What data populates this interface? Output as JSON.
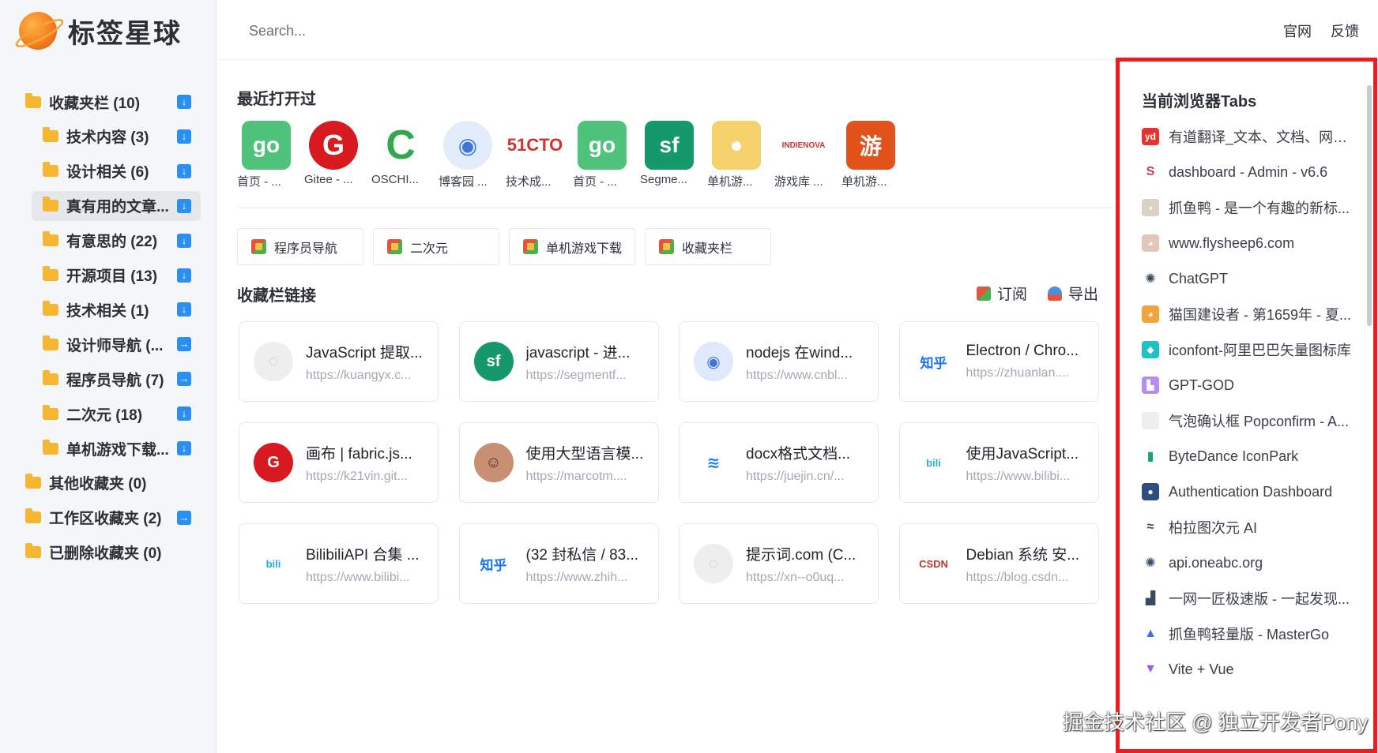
{
  "app": {
    "logo_text": "标签星球",
    "search_placeholder": "Search...",
    "links": [
      "官网",
      "反馈"
    ]
  },
  "sidebar": {
    "folders": [
      {
        "label": "收藏夹栏 (10)",
        "level": 0,
        "action": "download-icon"
      },
      {
        "label": "技术内容 (3)",
        "level": 1,
        "action": "download-icon"
      },
      {
        "label": "设计相关 (6)",
        "level": 1,
        "action": "download-icon"
      },
      {
        "label": "真有用的文章...",
        "level": 1,
        "action": "download-icon",
        "active": true
      },
      {
        "label": "有意思的 (22)",
        "level": 1,
        "action": "download-icon"
      },
      {
        "label": "开源项目 (13)",
        "level": 1,
        "action": "download-icon"
      },
      {
        "label": "技术相关 (1)",
        "level": 1,
        "action": "download-icon"
      },
      {
        "label": "设计师导航 (...",
        "level": 1,
        "action": "arrow-right-icon"
      },
      {
        "label": "程序员导航 (7)",
        "level": 1,
        "action": "arrow-right-icon"
      },
      {
        "label": "二次元 (18)",
        "level": 1,
        "action": "download-icon"
      },
      {
        "label": "单机游戏下载...",
        "level": 1,
        "action": "download-icon"
      },
      {
        "label": "其他收藏夹 (0)",
        "level": 0,
        "action": null
      },
      {
        "label": "工作区收藏夹 (2)",
        "level": 0,
        "action": "arrow-right-icon"
      },
      {
        "label": "已删除收藏夹 (0)",
        "level": 0,
        "action": null
      }
    ]
  },
  "recent": {
    "title": "最近打开过",
    "items": [
      {
        "label": "首页 - ...",
        "icon": "90-icon",
        "color": "#4fc37b",
        "glyph": "ɡo"
      },
      {
        "label": "Gitee - ...",
        "icon": "gitee-icon",
        "color": "#d71920",
        "glyph": "G"
      },
      {
        "label": "OSCHI...",
        "icon": "oschina-icon",
        "color": "#2fa84f",
        "glyph": "C"
      },
      {
        "label": "博客园 ...",
        "icon": "cnblogs-icon",
        "color": "#3d76d6",
        "glyph": "◉"
      },
      {
        "label": "技术成...",
        "icon": "51cto-icon",
        "color": "#ffffff",
        "glyph": "51CTO"
      },
      {
        "label": "首页 - ...",
        "icon": "90-icon",
        "color": "#4fc37b",
        "glyph": "ɡo"
      },
      {
        "label": "Segme...",
        "icon": "segmentfault-icon",
        "color": "#15996a",
        "glyph": "sf"
      },
      {
        "label": "单机游...",
        "icon": "pufferfish-icon",
        "color": "#f5d26b",
        "glyph": "●"
      },
      {
        "label": "游戏库 ...",
        "icon": "indienova-icon",
        "color": "#ffffff",
        "glyph": "INDIENOVA"
      },
      {
        "label": "单机游...",
        "icon": "game-icon",
        "color": "#e2531c",
        "glyph": "游"
      }
    ]
  },
  "chips": [
    "程序员导航",
    "二次元",
    "单机游戏下载",
    "收藏夹栏"
  ],
  "links_section": {
    "title": "收藏栏链接",
    "subscribe_label": "订阅",
    "export_label": "导出",
    "cards": [
      {
        "title": "JavaScript 提取...",
        "url": "https://kuangyx.c...",
        "icon": "planet-icon",
        "bg": "#eeeeee",
        "fg": "#bdbdbd",
        "glyph": "◌"
      },
      {
        "title": "javascript - 进...",
        "url": "https://segmentf...",
        "icon": "segmentfault-icon",
        "bg": "#15996a",
        "fg": "#ffffff",
        "glyph": "sf"
      },
      {
        "title": "nodejs 在wind...",
        "url": "https://www.cnbl...",
        "icon": "cnblogs-icon",
        "bg": "#dfe9fb",
        "fg": "#3d76d6",
        "glyph": "◉"
      },
      {
        "title": "Electron / Chro...",
        "url": "https://zhuanlan....",
        "icon": "zhihu-icon",
        "bg": "#ffffff",
        "fg": "#1772f6",
        "glyph": "知乎"
      },
      {
        "title": "画布 | fabric.js...",
        "url": "https://k21vin.git...",
        "icon": "gitee-icon",
        "bg": "#d71920",
        "fg": "#ffffff",
        "glyph": "G"
      },
      {
        "title": "使用大型语言模...",
        "url": "https://marcotm....",
        "icon": "avatar-icon",
        "bg": "#c98f74",
        "fg": "#4a3128",
        "glyph": "☺"
      },
      {
        "title": "docx格式文档...",
        "url": "https://juejin.cn/...",
        "icon": "juejin-icon",
        "bg": "#ffffff",
        "fg": "#1e80ff",
        "glyph": "≋"
      },
      {
        "title": "使用JavaScript...",
        "url": "https://www.bilibi...",
        "icon": "bilibili-icon",
        "bg": "#ffffff",
        "fg": "#23ade5",
        "glyph": "bili"
      },
      {
        "title": "BilibiliAPI 合集 ...",
        "url": "https://www.bilibi...",
        "icon": "bilibili-icon",
        "bg": "#ffffff",
        "fg": "#23ade5",
        "glyph": "bili"
      },
      {
        "title": "(32 封私信 / 83...",
        "url": "https://www.zhih...",
        "icon": "zhihu-icon",
        "bg": "#ffffff",
        "fg": "#1772f6",
        "glyph": "知乎"
      },
      {
        "title": "提示词.com (C...",
        "url": "https://xn--o0uq...",
        "icon": "planet-icon",
        "bg": "#eeeeee",
        "fg": "#bdbdbd",
        "glyph": "◌"
      },
      {
        "title": "Debian 系统 安...",
        "url": "https://blog.csdn...",
        "icon": "csdn-icon",
        "bg": "#ffffff",
        "fg": "#c0392b",
        "glyph": "CSDN"
      }
    ]
  },
  "browser_tabs": {
    "title": "当前浏览器Tabs",
    "items": [
      {
        "label": "有道翻译_文本、文档、网页...",
        "icon": "youdao-icon",
        "color": "#e3342f",
        "glyph": "yd"
      },
      {
        "label": "dashboard - Admin - v6.6",
        "icon": "s-logo-icon",
        "color": "#ffffff",
        "glyph": "S"
      },
      {
        "label": "抓鱼鸭 - 是一个有趣的新标...",
        "icon": "duck-icon",
        "color": "#d9d2c5",
        "glyph": "◖"
      },
      {
        "label": "www.flysheep6.com",
        "icon": "sheep-icon",
        "color": "#e0c7b8",
        "glyph": "◕"
      },
      {
        "label": "ChatGPT",
        "icon": "openai-icon",
        "color": "#ffffff",
        "glyph": "✺"
      },
      {
        "label": "猫国建设者 - 第1659年 - 夏...",
        "icon": "cat-icon",
        "color": "#f2a43c",
        "glyph": "◕"
      },
      {
        "label": "iconfont-阿里巴巴矢量图标库",
        "icon": "iconfont-icon",
        "color": "#1fc0c7",
        "glyph": "◆"
      },
      {
        "label": "GPT-GOD",
        "icon": "gptgod-icon",
        "color": "#b58cf0",
        "glyph": "▙"
      },
      {
        "label": "气泡确认框 Popconfirm - A...",
        "icon": "blank-icon",
        "color": "#eeeeee",
        "glyph": ""
      },
      {
        "label": "ByteDance IconPark",
        "icon": "iconpark-icon",
        "color": "#ffffff",
        "glyph": "▮"
      },
      {
        "label": "Authentication Dashboard",
        "icon": "auth-icon",
        "color": "#2d4e7e",
        "glyph": "●"
      },
      {
        "label": "柏拉图次元 AI",
        "icon": "plato-icon",
        "color": "#ffffff",
        "glyph": "≈"
      },
      {
        "label": "api.oneabc.org",
        "icon": "openai-icon",
        "color": "#ffffff",
        "glyph": "✺"
      },
      {
        "label": "一网一匠极速版 - 一起发现...",
        "icon": "bars-icon",
        "color": "#ffffff",
        "glyph": "▟"
      },
      {
        "label": "抓鱼鸭轻量版 - MasterGo",
        "icon": "mastergo-icon",
        "color": "#ffffff",
        "glyph": "▲"
      },
      {
        "label": "Vite + Vue",
        "icon": "vite-icon",
        "color": "#ffffff",
        "glyph": "▼"
      }
    ]
  },
  "watermark": "掘金技术社区 @ 独立开发者Pony"
}
